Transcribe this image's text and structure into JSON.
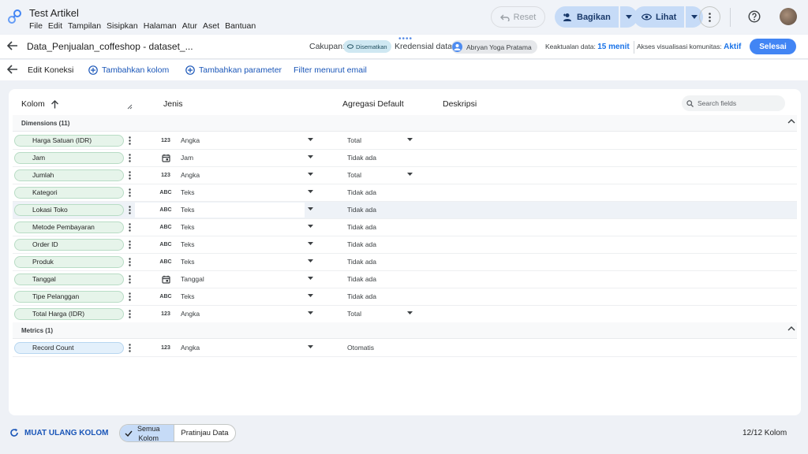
{
  "app": {
    "doc_title": "Test Artikel",
    "menu": [
      "File",
      "Edit",
      "Tampilan",
      "Sisipkan",
      "Halaman",
      "Atur",
      "Aset",
      "Bantuan"
    ],
    "reset_label": "Reset",
    "share_label": "Bagikan",
    "view_label": "Lihat"
  },
  "toolbar": {
    "datasource_title": "Data_Penjualan_coffeshop - dataset_...",
    "scope_label": "Cakupan:",
    "scope_value": "Disematkan",
    "credential_label": "Kredensial data:",
    "credential_user": "Abryan Yoga Pratama",
    "freshness_label": "Keaktualan data:",
    "freshness_value": "15 menit",
    "community_label": "Akses visualisasi komunitas:",
    "community_value": "Aktif",
    "done_label": "Selesai"
  },
  "actions": {
    "edit_connection": "Edit Koneksi",
    "add_field": "Tambahkan kolom",
    "add_parameter": "Tambahkan parameter",
    "filter_email": "Filter menurut email"
  },
  "table": {
    "headers": {
      "field": "Kolom",
      "type": "Jenis",
      "aggregation": "Agregasi Default",
      "description": "Deskripsi"
    },
    "search_placeholder": "Search fields",
    "dimensions_label": "Dimensions (11)",
    "metrics_label": "Metrics (1)",
    "dimensions": [
      {
        "name": "Harga Satuan (IDR)",
        "type_icon": "123",
        "type": "Angka",
        "aggregation": "Total"
      },
      {
        "name": "Jam",
        "type_icon": "calendar-icon",
        "type": "Jam",
        "aggregation": "Tidak ada"
      },
      {
        "name": "Jumlah",
        "type_icon": "123",
        "type": "Angka",
        "aggregation": "Total"
      },
      {
        "name": "Kategori",
        "type_icon": "ABC",
        "type": "Teks",
        "aggregation": "Tidak ada"
      },
      {
        "name": "Lokasi Toko",
        "type_icon": "ABC",
        "type": "Teks",
        "aggregation": "Tidak ada"
      },
      {
        "name": "Metode Pembayaran",
        "type_icon": "ABC",
        "type": "Teks",
        "aggregation": "Tidak ada"
      },
      {
        "name": "Order ID",
        "type_icon": "ABC",
        "type": "Teks",
        "aggregation": "Tidak ada"
      },
      {
        "name": "Produk",
        "type_icon": "ABC",
        "type": "Teks",
        "aggregation": "Tidak ada"
      },
      {
        "name": "Tanggal",
        "type_icon": "calendar-icon",
        "type": "Tanggal",
        "aggregation": "Tidak ada"
      },
      {
        "name": "Tipe Pelanggan",
        "type_icon": "ABC",
        "type": "Teks",
        "aggregation": "Tidak ada"
      },
      {
        "name": "Total Harga (IDR)",
        "type_icon": "123",
        "type": "Angka",
        "aggregation": "Total"
      }
    ],
    "metrics": [
      {
        "name": "Record Count",
        "type_icon": "123",
        "type": "Angka",
        "aggregation": "Otomatis"
      }
    ]
  },
  "footer": {
    "refresh_label": "MUAT ULANG KOLOM",
    "seg_all_line1": "Semua",
    "seg_all_line2": "Kolom",
    "seg_preview": "Pratinjau Data",
    "field_count": "12/12 Kolom"
  },
  "colors": {
    "accent": "#1a73e8",
    "done_button": "#4285f4",
    "dimension_pill": "#e6f4ea",
    "metric_pill": "#e3f0fb"
  }
}
